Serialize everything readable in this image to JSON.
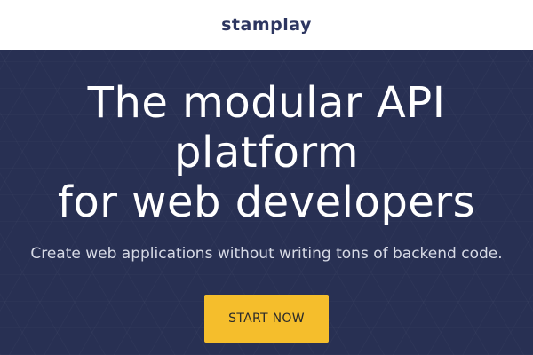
{
  "header": {
    "logo_text": "stamplay"
  },
  "hero": {
    "headline_lines": [
      "The modular API",
      "platform",
      "for web developers"
    ],
    "subtitle": "Create web applications without writing tons of backend code.",
    "cta_label": "START NOW"
  },
  "colors": {
    "hero_background": "#283053",
    "logo": "#2d3660",
    "cta_background": "#f5be2c"
  }
}
